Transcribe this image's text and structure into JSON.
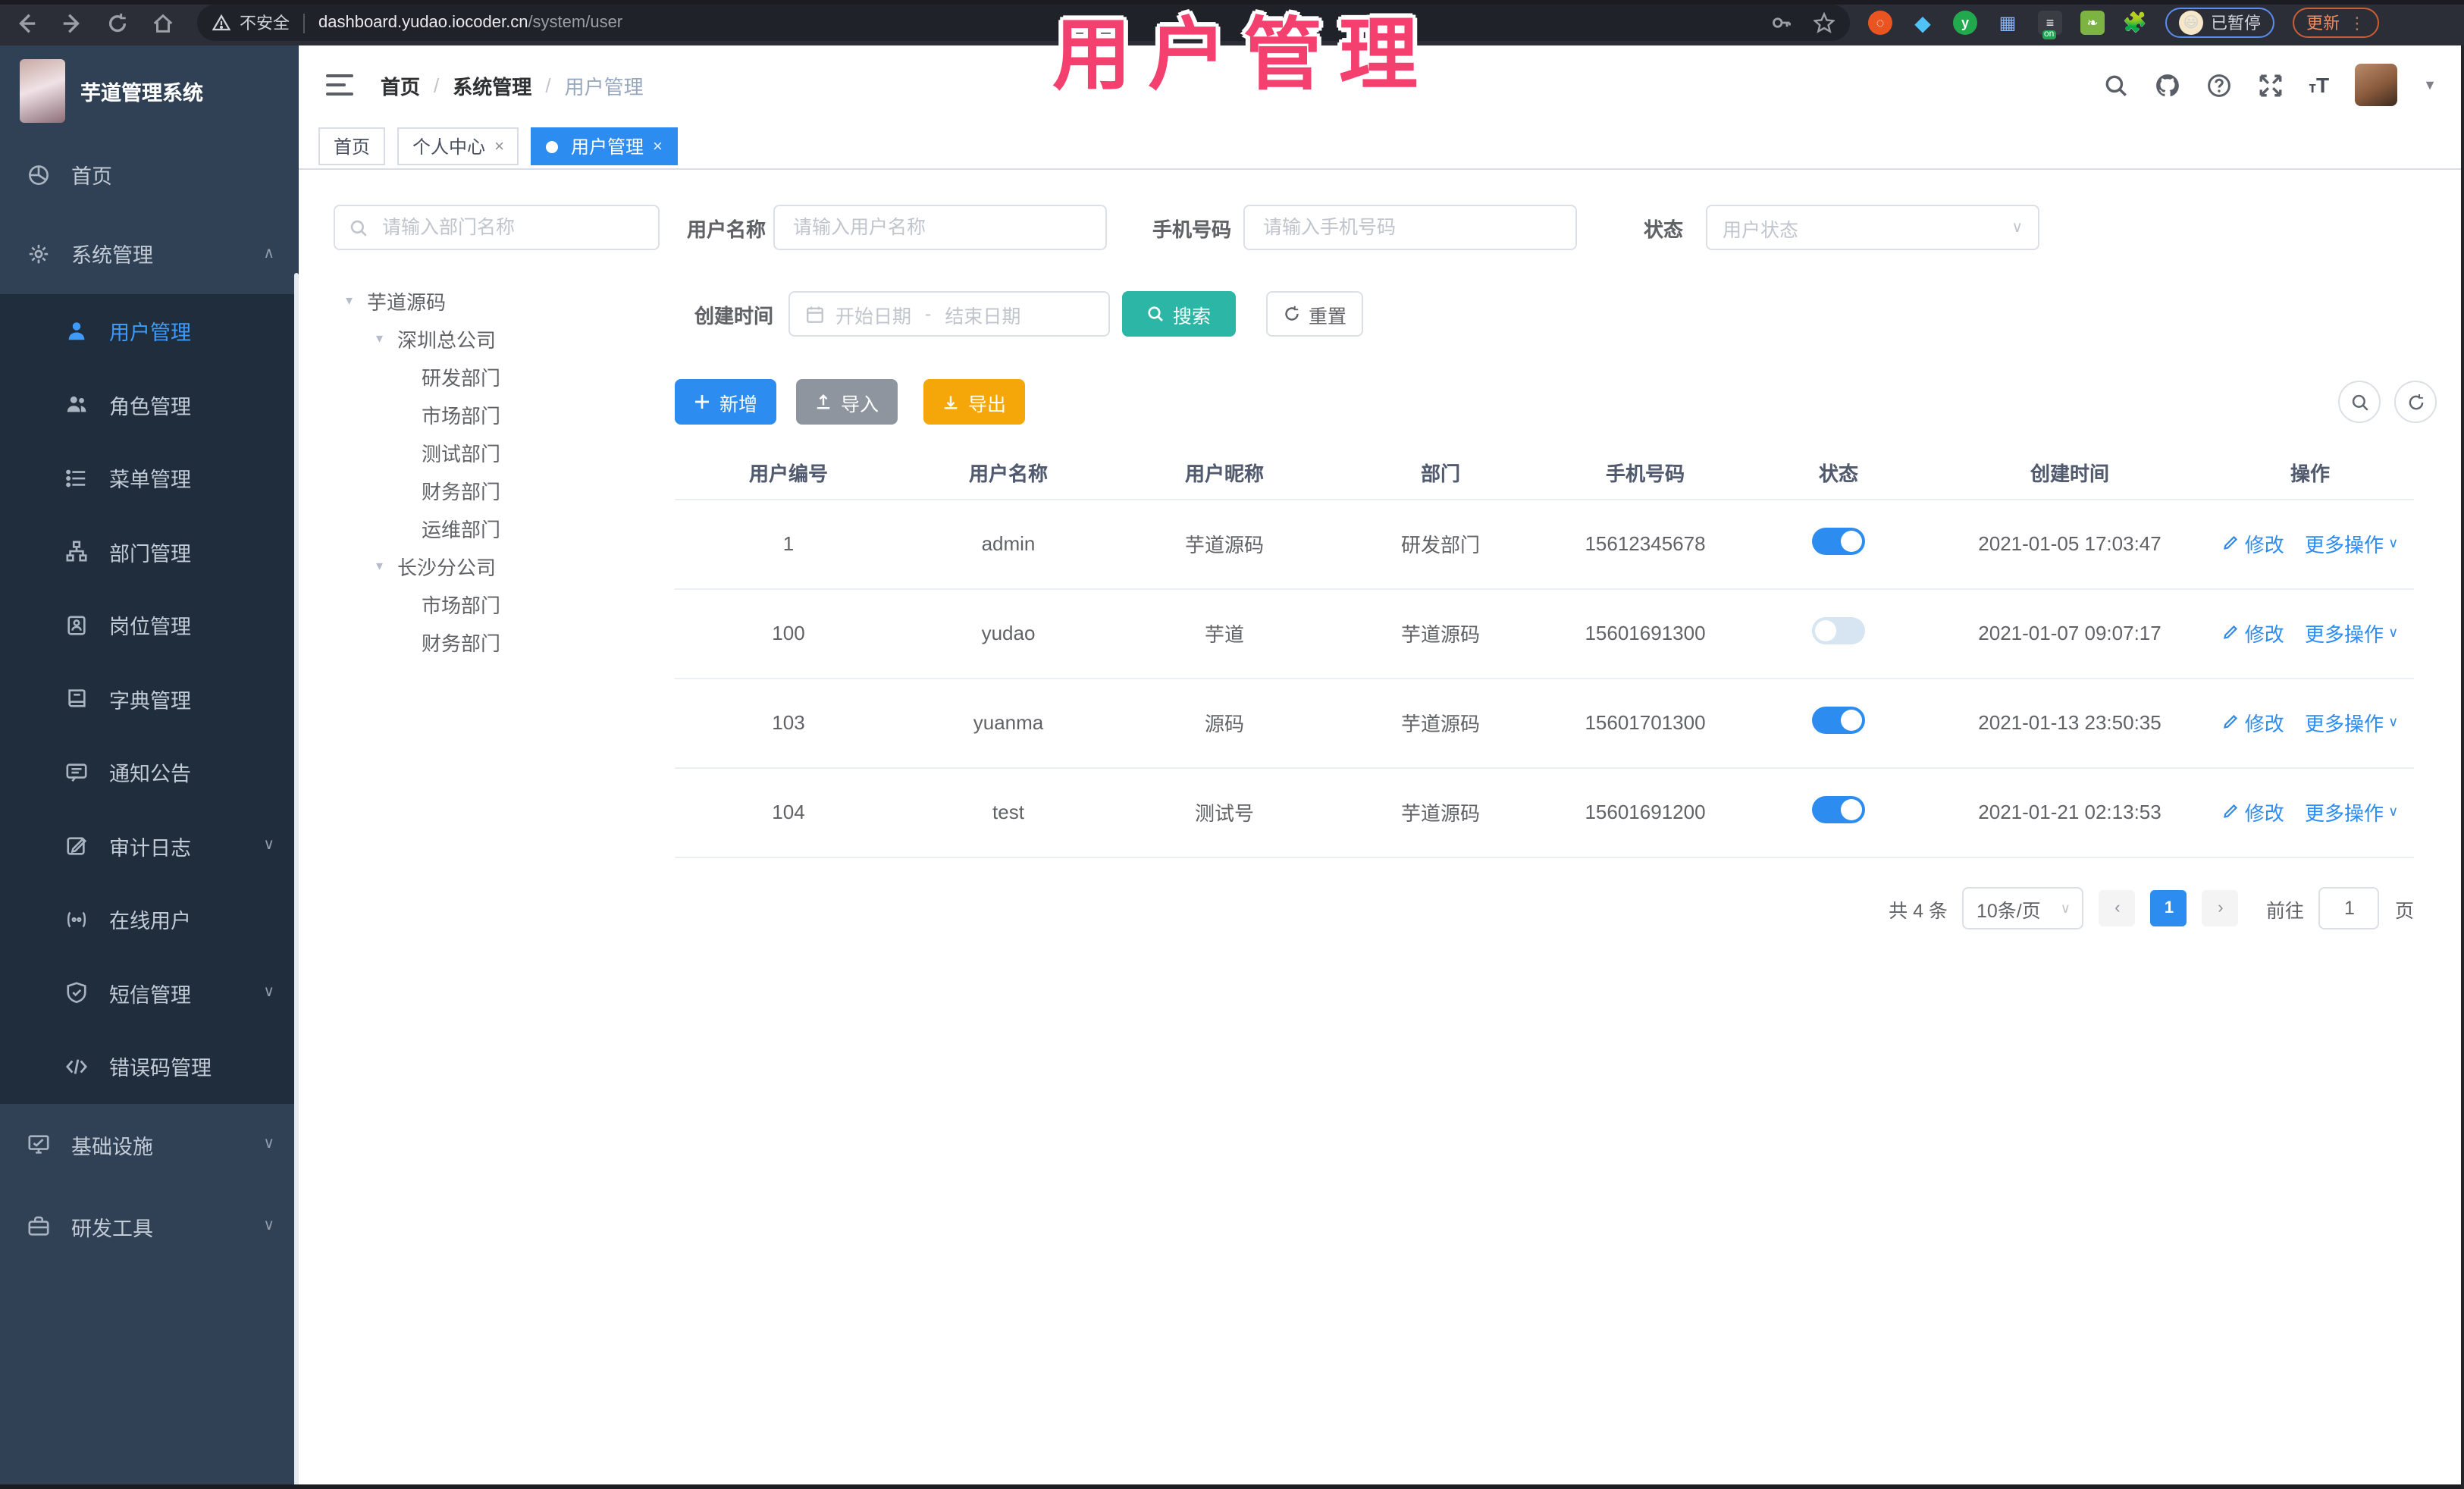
{
  "chrome": {
    "security_label": "不安全",
    "url_host": "dashboard.yudao.iocoder.cn",
    "url_path": "/system/user",
    "paused_badge": "已暂停",
    "update_button": "更新",
    "on_badge": "on"
  },
  "header": {
    "app_title": "芋道管理系统",
    "breadcrumb": [
      "首页",
      "系统管理",
      "用户管理"
    ]
  },
  "tabs": [
    {
      "label": "首页"
    },
    {
      "label": "个人中心"
    },
    {
      "label": "用户管理"
    }
  ],
  "sidebar": {
    "items": [
      {
        "label": "首页"
      },
      {
        "label": "系统管理"
      },
      {
        "label": "用户管理"
      },
      {
        "label": "角色管理"
      },
      {
        "label": "菜单管理"
      },
      {
        "label": "部门管理"
      },
      {
        "label": "岗位管理"
      },
      {
        "label": "字典管理"
      },
      {
        "label": "通知公告"
      },
      {
        "label": "审计日志"
      },
      {
        "label": "在线用户"
      },
      {
        "label": "短信管理"
      },
      {
        "label": "错误码管理"
      },
      {
        "label": "基础设施"
      },
      {
        "label": "研发工具"
      }
    ]
  },
  "dept_panel": {
    "search_placeholder": "请输入部门名称",
    "tree": [
      {
        "label": "芋道源码"
      },
      {
        "label": "深圳总公司"
      },
      {
        "label": "研发部门"
      },
      {
        "label": "市场部门"
      },
      {
        "label": "测试部门"
      },
      {
        "label": "财务部门"
      },
      {
        "label": "运维部门"
      },
      {
        "label": "长沙分公司"
      },
      {
        "label": "市场部门"
      },
      {
        "label": "财务部门"
      }
    ]
  },
  "filters": {
    "username_label": "用户名称",
    "username_placeholder": "请输入用户名称",
    "mobile_label": "手机号码",
    "mobile_placeholder": "请输入手机号码",
    "status_label": "状态",
    "status_placeholder": "用户状态",
    "create_time_label": "创建时间",
    "start_placeholder": "开始日期",
    "range_separator": "-",
    "end_placeholder": "结束日期",
    "search_button": "搜索",
    "reset_button": "重置"
  },
  "toolbar": {
    "add_button": "新增",
    "import_button": "导入",
    "export_button": "导出"
  },
  "table": {
    "headers": [
      "用户编号",
      "用户名称",
      "用户昵称",
      "部门",
      "手机号码",
      "状态",
      "创建时间",
      "操作"
    ],
    "modify_label": "修改",
    "more_label": "更多操作",
    "rows": [
      {
        "id": "1",
        "username": "admin",
        "nickname": "芋道源码",
        "dept": "研发部门",
        "mobile": "15612345678",
        "status": "on",
        "created": "2021-01-05 17:03:47"
      },
      {
        "id": "100",
        "username": "yudao",
        "nickname": "芋道",
        "dept": "芋道源码",
        "mobile": "15601691300",
        "status": "off",
        "created": "2021-01-07 09:07:17"
      },
      {
        "id": "103",
        "username": "yuanma",
        "nickname": "源码",
        "dept": "芋道源码",
        "mobile": "15601701300",
        "status": "on",
        "created": "2021-01-13 23:50:35"
      },
      {
        "id": "104",
        "username": "test",
        "nickname": "测试号",
        "dept": "芋道源码",
        "mobile": "15601691200",
        "status": "on",
        "created": "2021-01-21 02:13:53"
      }
    ]
  },
  "pagination": {
    "total": "共 4 条",
    "page_size": "10条/页",
    "current_page": "1",
    "goto_label": "前往",
    "goto_value": "1",
    "page_unit": "页"
  },
  "overlay": {
    "title": "用户管理"
  },
  "colors": {
    "primary": "#2d8cf0",
    "teal": "#2cb6a5",
    "warning": "#f5a70a",
    "pink": "#f4406f",
    "sidebar": "#304156",
    "submenu": "#1f2d3d"
  }
}
